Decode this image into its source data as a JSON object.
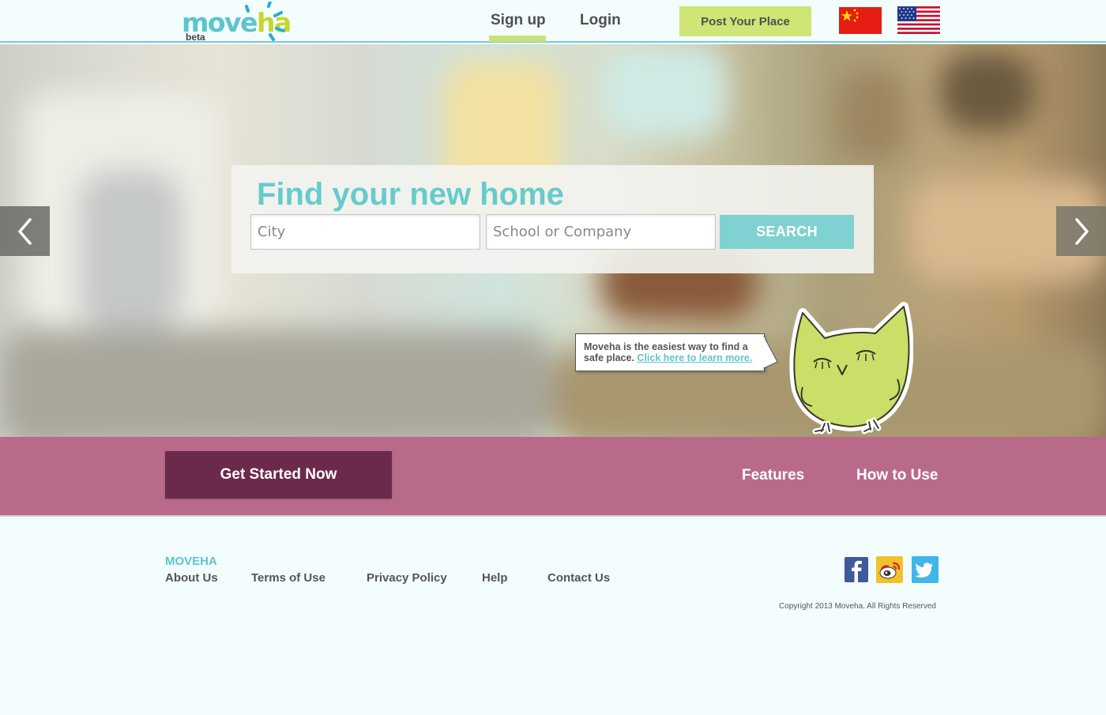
{
  "header": {
    "logo": {
      "word_start": "move",
      "word_end": "ha",
      "badge": "beta"
    },
    "nav": {
      "signup": "Sign up",
      "login": "Login"
    },
    "post_button": "Post Your Place",
    "languages": [
      {
        "name": "china-flag-icon"
      },
      {
        "name": "usa-flag-icon"
      }
    ]
  },
  "hero": {
    "title": "Find your new home",
    "city_placeholder": "City",
    "school_placeholder": "School or Company",
    "search_label": "SEARCH",
    "bubble": {
      "text": "Moveha is the easiest way to find a safe place.",
      "link": "Click here to learn more."
    },
    "prev_icon": "chevron-left-icon",
    "next_icon": "chevron-right-icon",
    "mascot": "owl-mascot"
  },
  "band": {
    "cta": "Get Started Now",
    "links": {
      "features": "Features",
      "how_to_use": "How to Use"
    }
  },
  "footer": {
    "brand": "MOVEHA",
    "links": {
      "about": "About Us",
      "terms": "Terms of Use",
      "privacy": "Privacy Policy",
      "help": "Help",
      "contact": "Contact Us"
    },
    "social": [
      "facebook-icon",
      "weibo-icon",
      "twitter-icon"
    ],
    "copyright": "Copyright 2013 Moveha.  All Rights Reserved"
  },
  "colors": {
    "teal": "#5cc5cc",
    "lime": "#cfe575",
    "plum": "#6b2a4b",
    "band": "#b96a8b",
    "page": "#f3fdfd"
  }
}
